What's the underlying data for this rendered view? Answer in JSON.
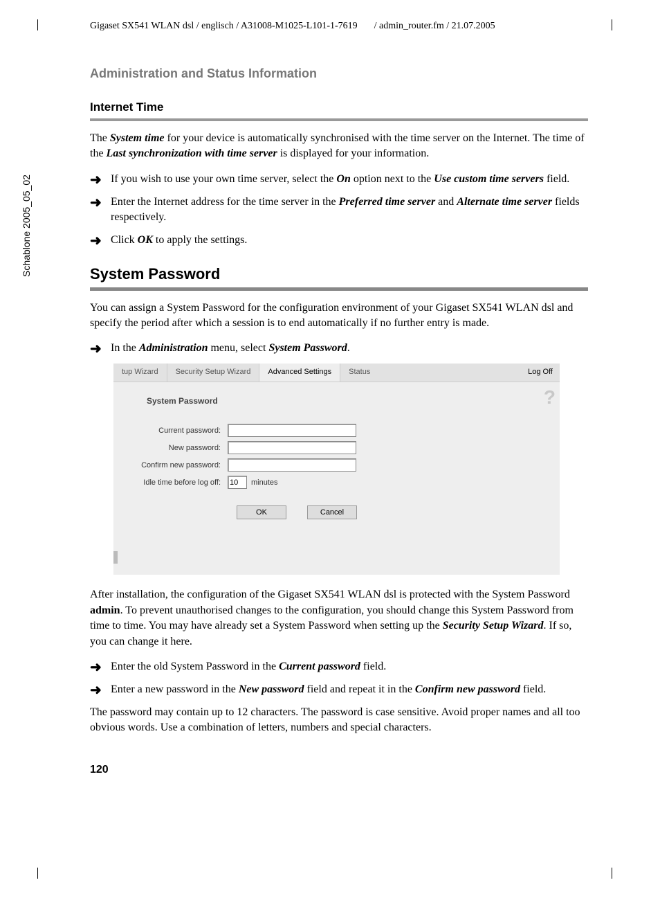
{
  "header": {
    "left": "Gigaset SX541 WLAN dsl / englisch / A31008-M1025-L101-1-7619",
    "right": "/ admin_router.fm / 21.07.2005"
  },
  "side_text": "Schablone 2005_05_02",
  "section_heading": "Administration and Status Information",
  "internet_time": {
    "title": "Internet Time",
    "para1_a": "The ",
    "para1_b": "System time",
    "para1_c": " for your device is automatically synchronised with the time server on the Internet. The time of the ",
    "para1_d": "Last synchronization with time server",
    "para1_e": " is displayed for your information.",
    "b1_a": "If you wish to use your own time server, select the ",
    "b1_b": "On",
    "b1_c": " option next to the ",
    "b1_d": "Use custom time servers",
    "b1_e": " field.",
    "b2_a": "Enter the Internet address for the time server in the ",
    "b2_b": "Preferred time server",
    "b2_c": " and ",
    "b2_d": "Alternate time server",
    "b2_e": " fields respectively.",
    "b3_a": "Click ",
    "b3_b": "OK",
    "b3_c": " to apply the settings."
  },
  "system_password": {
    "title": "System Password",
    "para1": "You can assign a System Password for the configuration environment of your Gigaset SX541 WLAN dsl and specify the period after which a session is to end automatically if no further entry is made.",
    "b1_a": "In the ",
    "b1_b": "Administration",
    "b1_c": " menu, select ",
    "b1_d": "System Password",
    "b1_e": ".",
    "para2_a": "After installation, the configuration of the Gigaset SX541 WLAN dsl is protected with the System Password ",
    "para2_b": "admin",
    "para2_c": ". To prevent unauthorised changes to the configuration, you should change this System Password from time to time. You may have already set a System Password when setting up the ",
    "para2_d": "Security Setup Wizard",
    "para2_e": ". If so, you can change it here.",
    "b2_a": "Enter the old System Password in the ",
    "b2_b": "Current password",
    "b2_c": " field.",
    "b3_a": "Enter a new password in the ",
    "b3_b": "New password",
    "b3_c": " field and repeat it in the ",
    "b3_d": "Confirm new password",
    "b3_e": " field.",
    "para3": "The password may contain up to 12 characters. The password is case sensitive. Avoid proper names and all too obvious words. Use a combination of letters, numbers and special characters."
  },
  "ui": {
    "tabs": {
      "t1": "tup Wizard",
      "t2": "Security Setup Wizard",
      "t3": "Advanced Settings",
      "t4": "Status",
      "logoff": "Log Off"
    },
    "title": "System Password",
    "help": "?",
    "labels": {
      "current": "Current password:",
      "new": "New password:",
      "confirm": "Confirm new password:",
      "idle": "Idle time before log off:"
    },
    "idle_value": "10",
    "idle_unit": "minutes",
    "buttons": {
      "ok": "OK",
      "cancel": "Cancel"
    }
  },
  "page_number": "120"
}
